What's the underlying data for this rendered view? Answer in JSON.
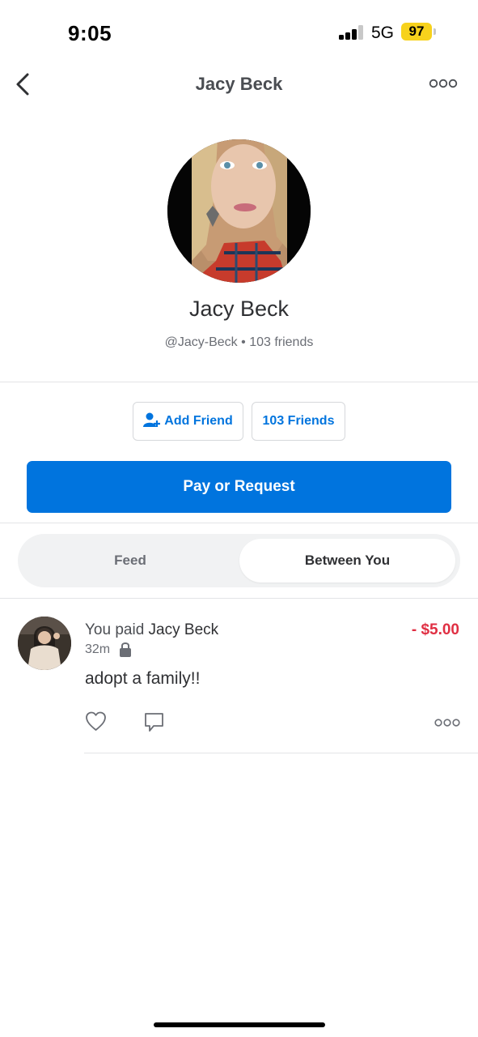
{
  "status_bar": {
    "time": "9:05",
    "network": "5G",
    "battery": "97"
  },
  "nav": {
    "title": "Jacy Beck",
    "back_icon": "chevron-left-icon",
    "more_icon": "more-dots-icon"
  },
  "profile": {
    "name": "Jacy Beck",
    "handle": "@Jacy-Beck",
    "separator": "•",
    "friends_count": "103 friends"
  },
  "actions": {
    "add_friend_label": "Add Friend",
    "add_friend_icon": "add-person-icon",
    "friends_label": "103 Friends",
    "pay_request_label": "Pay or Request"
  },
  "tabs": [
    {
      "label": "Feed",
      "selected": false
    },
    {
      "label": "Between You",
      "selected": true
    }
  ],
  "feed": [
    {
      "prefix": "You paid ",
      "name": "Jacy Beck",
      "amount": "- $5.00",
      "time": "32m",
      "privacy_icon": "lock-icon",
      "note": "adopt a family!!",
      "like_icon": "heart-icon",
      "comment_icon": "comment-icon",
      "more_icon": "more-dots-icon"
    }
  ],
  "colors": {
    "accent": "#0074de",
    "negative_amount": "#e02f43",
    "battery": "#f7d21c"
  }
}
